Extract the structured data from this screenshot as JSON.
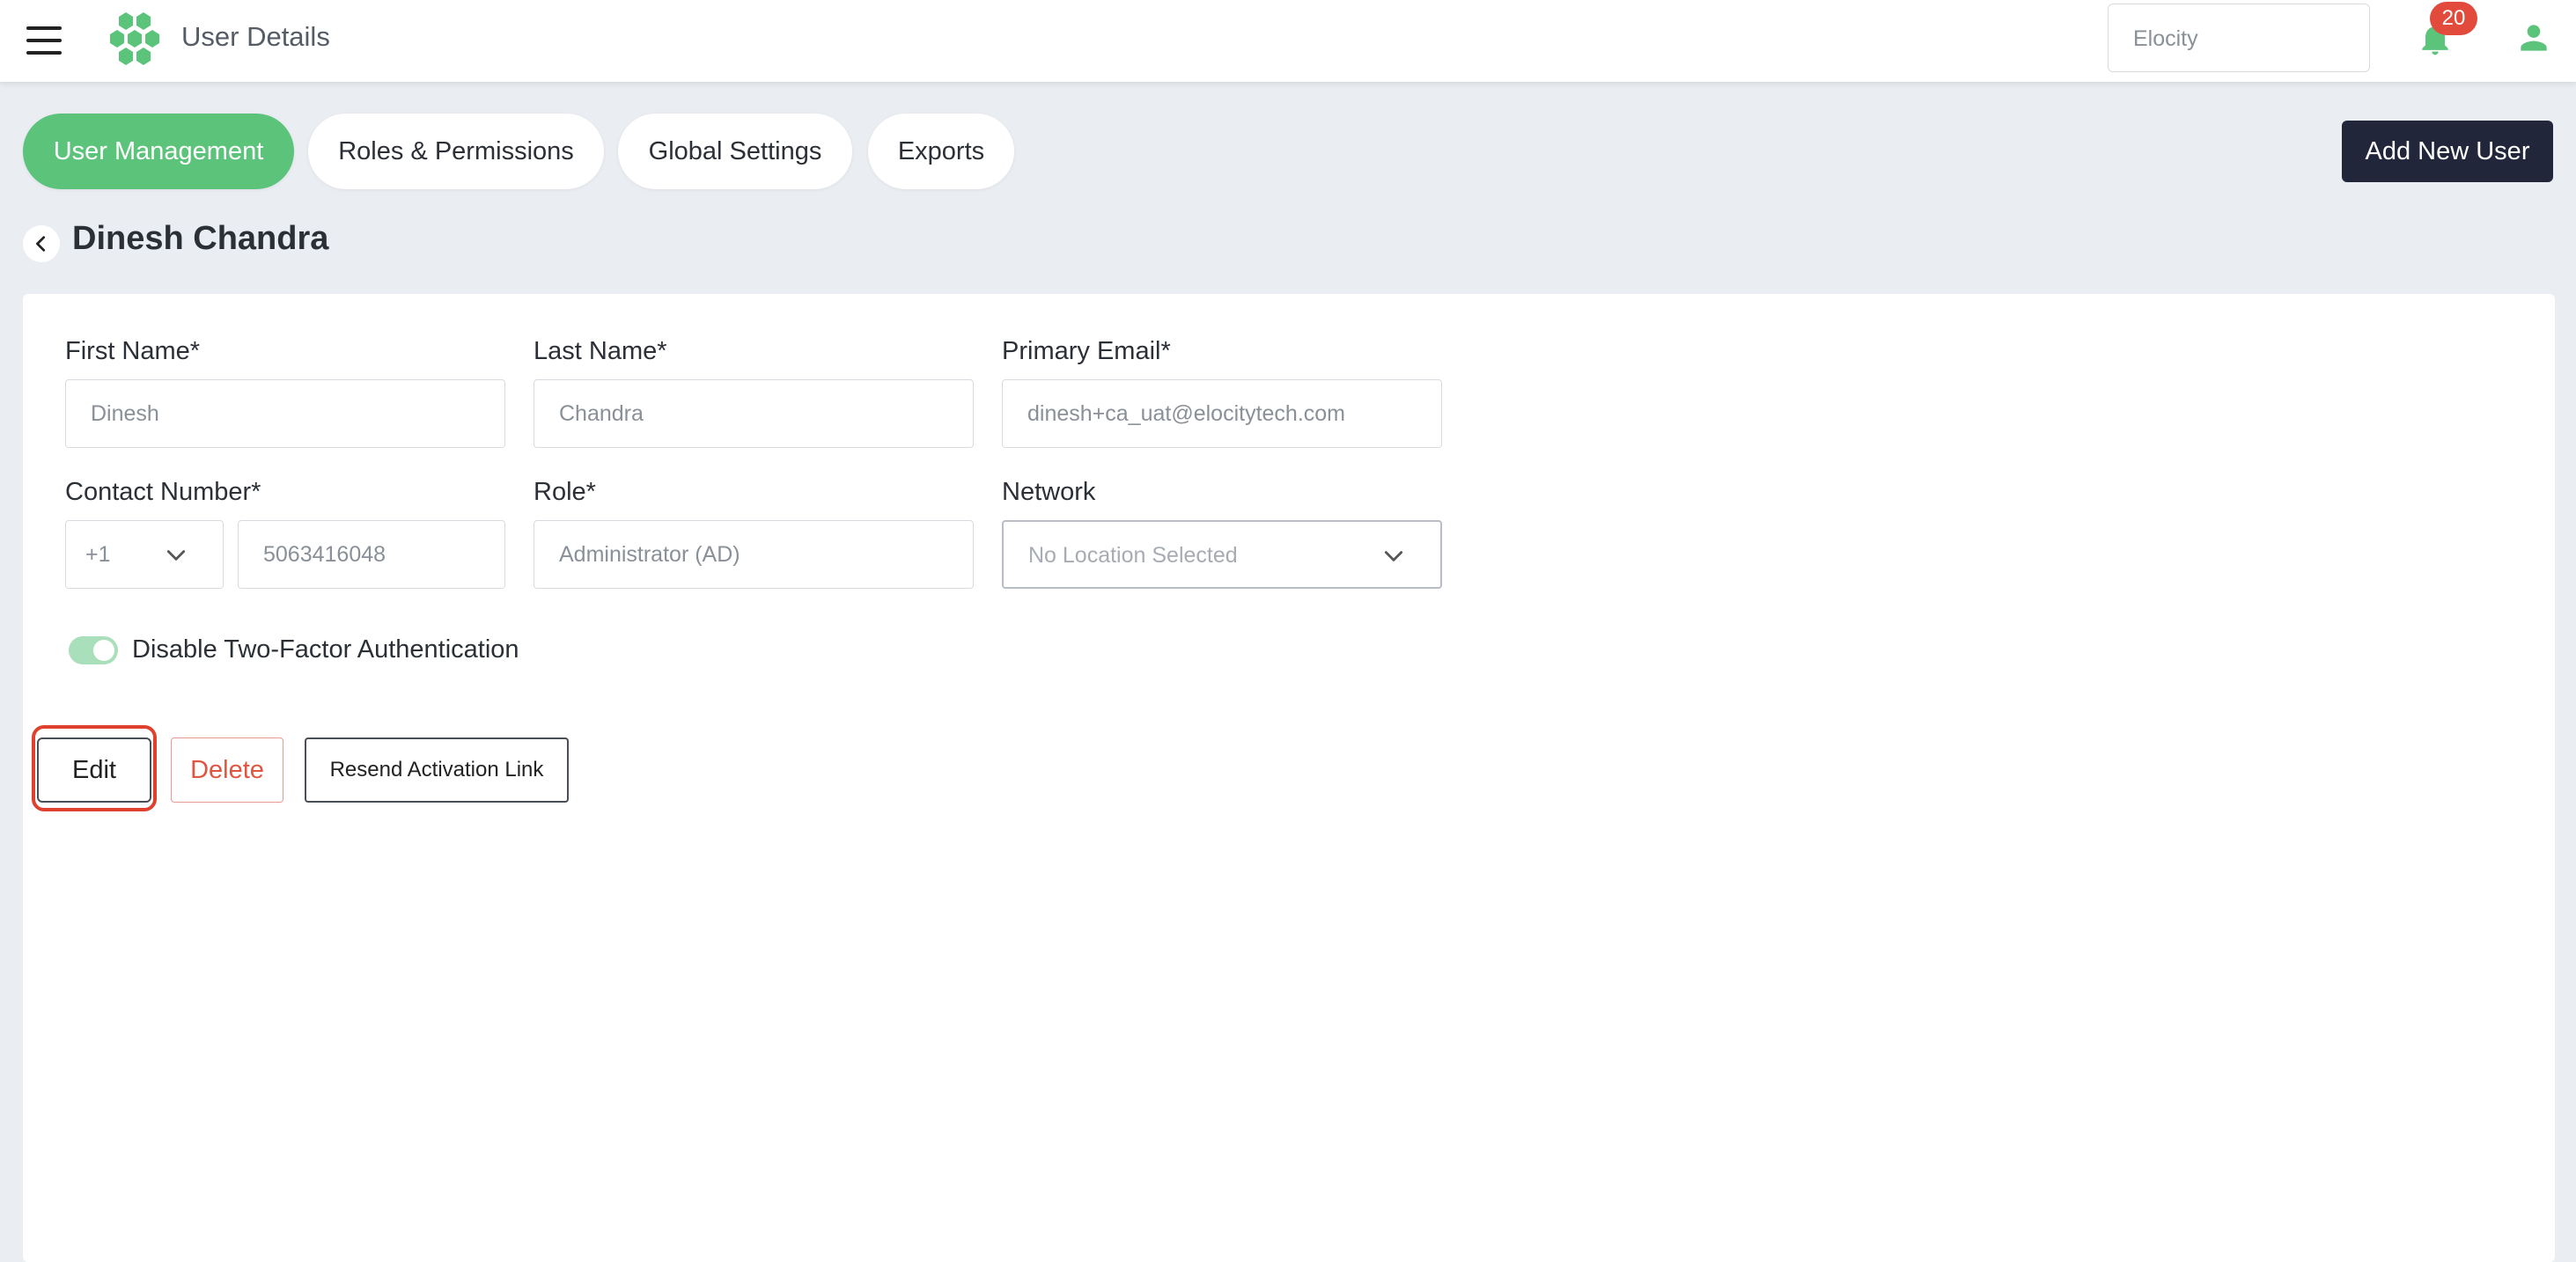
{
  "header": {
    "title": "User Details",
    "org_selector": "Elocity",
    "notification_count": "20",
    "icons": [
      "hamburger-menu-icon",
      "hexagon-logo-icon",
      "bell-icon",
      "user-profile-icon"
    ]
  },
  "tabs": [
    {
      "label": "User Management",
      "active": true
    },
    {
      "label": "Roles & Permissions",
      "active": false
    },
    {
      "label": "Global Settings",
      "active": false
    },
    {
      "label": "Exports",
      "active": false
    }
  ],
  "add_user_label": "Add New User",
  "page_title": "Dinesh Chandra",
  "form": {
    "first_name": {
      "label": "First Name*",
      "value": "Dinesh"
    },
    "last_name": {
      "label": "Last Name*",
      "value": "Chandra"
    },
    "primary_email": {
      "label": "Primary Email*",
      "value": "dinesh+ca_uat@elocitytech.com"
    },
    "contact_number": {
      "label": "Contact Number*",
      "country_code": "+1",
      "value": "5063416048"
    },
    "role": {
      "label": "Role*",
      "value": "Administrator (AD)"
    },
    "network": {
      "label": "Network",
      "placeholder": "No Location Selected"
    },
    "two_factor": {
      "label": "Disable Two-Factor Authentication",
      "enabled": true
    }
  },
  "actions": {
    "edit": "Edit",
    "delete": "Delete",
    "resend": "Resend Activation Link"
  },
  "colors": {
    "accent_green": "#5cc37a",
    "dark_button": "#22263b",
    "danger": "#e0553f",
    "background": "#eaedf2"
  }
}
